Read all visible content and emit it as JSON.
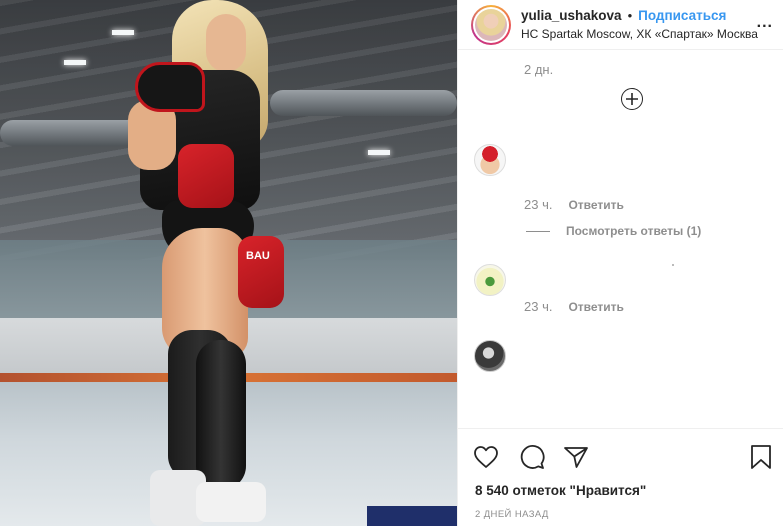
{
  "header": {
    "username": "yulia_ushakova",
    "separator": "•",
    "follow_label": "Подписаться",
    "location": "HC Spartak Moscow, ХК «Спартак» Москва",
    "more_label": "..."
  },
  "photo": {
    "brand_text": "BAU"
  },
  "comments": {
    "top_time": "2 дн.",
    "items": [
      {
        "time": "23 ч.",
        "reply_label": "Ответить"
      },
      {
        "time": "23 ч.",
        "reply_label": "Ответить"
      }
    ],
    "view_replies_label": "Посмотреть ответы (1)"
  },
  "actions": {
    "likes_text": "8 540 отметок \"Нравится\"",
    "time_ago": "2 ДНЕЙ НАЗАД",
    "icons": [
      "heart-icon",
      "comment-icon",
      "share-icon",
      "save-icon",
      "plus-circle-icon"
    ]
  },
  "colors": {
    "accent": "#3897f0",
    "secondary_text": "#8e8e8e",
    "primary_text": "#262626"
  }
}
